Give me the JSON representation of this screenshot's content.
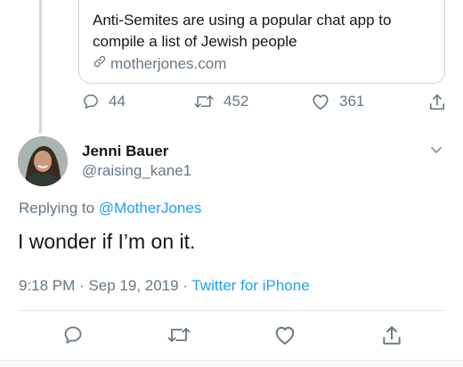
{
  "quoted_tweet": {
    "text": "Anti-Semites are using a popular chat app to compile a list of Jewish people",
    "link": "motherjones.com"
  },
  "quoted_actions": {
    "replies": "44",
    "retweets": "452",
    "likes": "361"
  },
  "author": {
    "name": "Jenni Bauer",
    "handle": "@raising_kane1"
  },
  "reply": {
    "prefix": "Replying to",
    "mention": "@MotherJones"
  },
  "tweet": {
    "text": "I wonder if I’m on it.",
    "timestamp": "9:18 PM · Sep 19, 2019 · ",
    "source": "Twitter for iPhone"
  },
  "icons": {
    "reply": "reply-icon",
    "retweet": "retweet-icon",
    "like": "heart-icon",
    "share": "share-icon",
    "link": "link-icon",
    "more": "chevron-down-icon"
  },
  "colors": {
    "accent": "#1da1f2",
    "secondary_text": "#657786"
  }
}
